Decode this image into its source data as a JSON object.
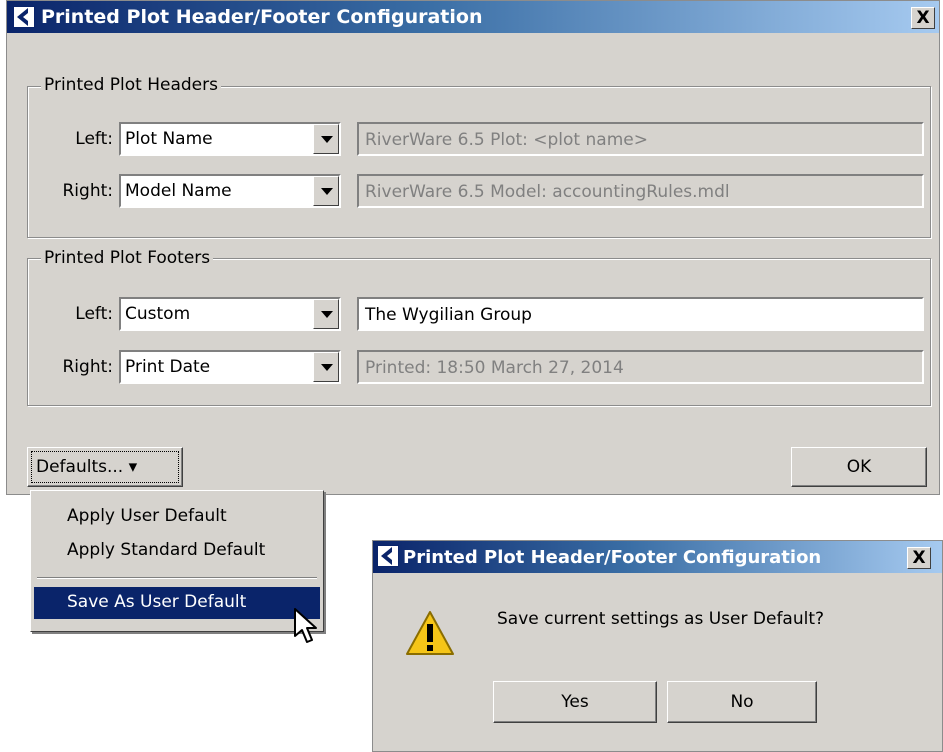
{
  "main_dialog": {
    "title": "Printed Plot Header/Footer Configuration",
    "close_label": "X",
    "headers_group": {
      "label": "Printed Plot Headers",
      "rows": [
        {
          "label": "Left:",
          "selected": "Plot Name",
          "text": "RiverWare 6.5 Plot: <plot name>",
          "editable": false
        },
        {
          "label": "Right:",
          "selected": "Model Name",
          "text": "RiverWare 6.5 Model: accountingRules.mdl",
          "editable": false
        }
      ]
    },
    "footers_group": {
      "label": "Printed Plot Footers",
      "rows": [
        {
          "label": "Left:",
          "selected": "Custom",
          "text": "The Wygilian Group",
          "editable": true
        },
        {
          "label": "Right:",
          "selected": "Print Date",
          "text": "Printed: 18:50 March 27, 2014",
          "editable": false
        }
      ]
    },
    "defaults_button": "Defaults... ▾",
    "ok_button": "OK"
  },
  "defaults_menu": {
    "items": [
      {
        "label": "Apply User Default",
        "selected": false
      },
      {
        "label": "Apply Standard Default",
        "selected": false
      },
      {
        "label": "Save As User Default",
        "selected": true
      }
    ]
  },
  "confirm_dialog": {
    "title": "Printed Plot Header/Footer Configuration",
    "close_label": "X",
    "icon": "warning-icon",
    "message": "Save current settings as User Default?",
    "yes_button": "Yes",
    "no_button": "No"
  },
  "colors": {
    "title_gradient_start": "#0a246a",
    "title_gradient_end": "#a6caf0",
    "dialog_face": "#d6d3ce",
    "menu_highlight": "#0a246a",
    "warning_yellow": "#f5c518"
  }
}
